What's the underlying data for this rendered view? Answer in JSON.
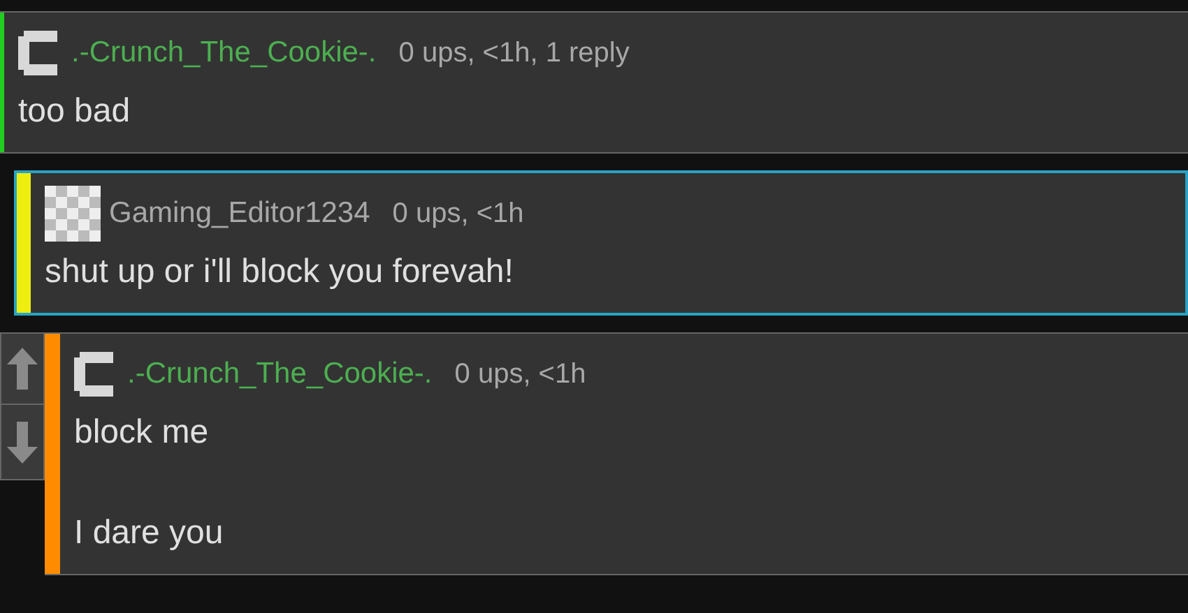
{
  "comments": [
    {
      "author": {
        "name": ".-Crunch_The_Cookie-.",
        "color": "#4caf50"
      },
      "kind": "bracket",
      "stats": "0 ups, <1h, 1 reply",
      "color": "#22cc22",
      "highlighted": false,
      "vote_buttons": false,
      "paragraphs": [
        "too bad"
      ],
      "children": [
        {
          "author": {
            "name": "Gaming_Editor1234",
            "color": "#a8a8a8"
          },
          "kind": "checker",
          "stats": "0 ups, <1h",
          "color": "#eeee11",
          "highlighted": true,
          "vote_buttons": false,
          "paragraphs": [
            "shut up or i'll block you forevah!"
          ],
          "children": [
            {
              "author": {
                "name": ".-Crunch_The_Cookie-.",
                "color": "#4caf50"
              },
              "kind": "bracket",
              "stats": "0 ups, <1h",
              "color": "#ff8c00",
              "highlighted": false,
              "vote_buttons": true,
              "paragraphs": [
                "block me",
                "I dare you"
              ]
            }
          ]
        }
      ]
    }
  ]
}
